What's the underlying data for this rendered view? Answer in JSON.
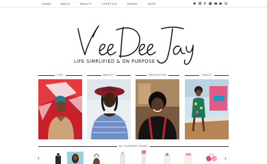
{
  "nav": {
    "items": [
      "HOME",
      "ABOUT",
      "BEAUTY",
      "LIFESTYLE",
      "TRAVEL",
      "SHOP"
    ]
  },
  "social": {
    "icons": [
      "twitter-icon",
      "instagram-icon",
      "facebook-icon",
      "pinterest-icon",
      "youtube-icon",
      "email-icon",
      "search-icon"
    ]
  },
  "site": {
    "logo_text": "VeeDeeJay",
    "tagline": "LIFE SIMPLIFIED & ON PURPOSE"
  },
  "categories": [
    {
      "label": "LIFE"
    },
    {
      "label": "BEAUTY"
    },
    {
      "label": "INSPIRATION"
    },
    {
      "label": "TRAVEL"
    }
  ],
  "faved": {
    "heading": "MY CURRENT FAVES",
    "prev": "‹",
    "next": "›"
  },
  "colors": {
    "accent": "#222222",
    "rule": "#333333"
  }
}
